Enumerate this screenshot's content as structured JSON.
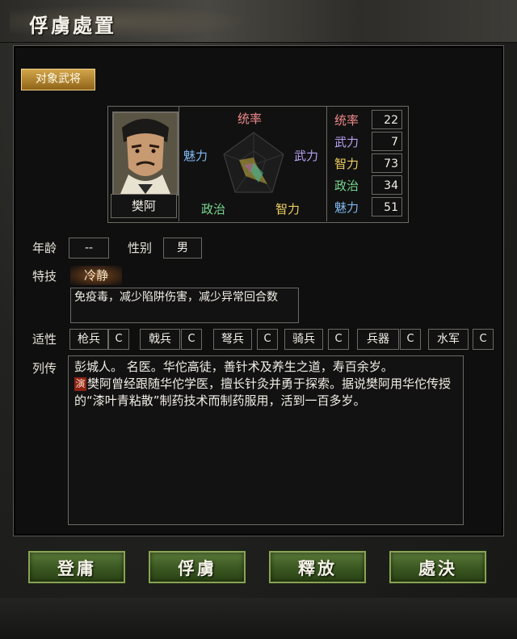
{
  "window": {
    "title": "俘虜處置"
  },
  "target_tag": "对象武将",
  "officer": {
    "name": "樊阿",
    "radar": {
      "top": "统率",
      "right": "武力",
      "bottom_right": "智力",
      "bottom_left": "政治",
      "left": "魅力"
    },
    "stats": [
      {
        "name": "统率",
        "value": "22",
        "color": "#f08a8a"
      },
      {
        "name": "武力",
        "value": "7",
        "color": "#b8a0f0"
      },
      {
        "name": "智力",
        "value": "73",
        "color": "#f0d060"
      },
      {
        "name": "政治",
        "value": "34",
        "color": "#78d890"
      },
      {
        "name": "魅力",
        "value": "51",
        "color": "#80b8f0"
      }
    ]
  },
  "info": {
    "age_label": "年龄",
    "age_value": "--",
    "gender_label": "性别",
    "gender_value": "男",
    "skill_label": "特技",
    "skill_name": "冷静",
    "skill_desc": "免疫毒，减少陷阱伤害，减少异常回合数"
  },
  "aptitude": {
    "label": "适性",
    "items": [
      {
        "name": "枪兵",
        "grade": "C"
      },
      {
        "name": "戟兵",
        "grade": "C"
      },
      {
        "name": "弩兵",
        "grade": "C"
      },
      {
        "name": "骑兵",
        "grade": "C"
      },
      {
        "name": "兵器",
        "grade": "C"
      },
      {
        "name": "水军",
        "grade": "C"
      }
    ]
  },
  "bio": {
    "label": "列传",
    "text1": "彭城人。 名医。华佗高徒，善针术及养生之道，寿百余岁。",
    "mark": "演",
    "text2": "樊阿曾经跟随华佗学医，擅长针灸并勇于探索。据说樊阿用华佗传授的“漆叶青粘散”制药技术而制药服用，活到一百多岁。"
  },
  "buttons": {
    "recruit": "登庸",
    "capture": "俘虜",
    "release": "釋放",
    "execute": "處決"
  },
  "colors": {
    "button_green": "#3c5a22",
    "tag_gold": "#c29232",
    "panel_border": "#6b6a64"
  }
}
